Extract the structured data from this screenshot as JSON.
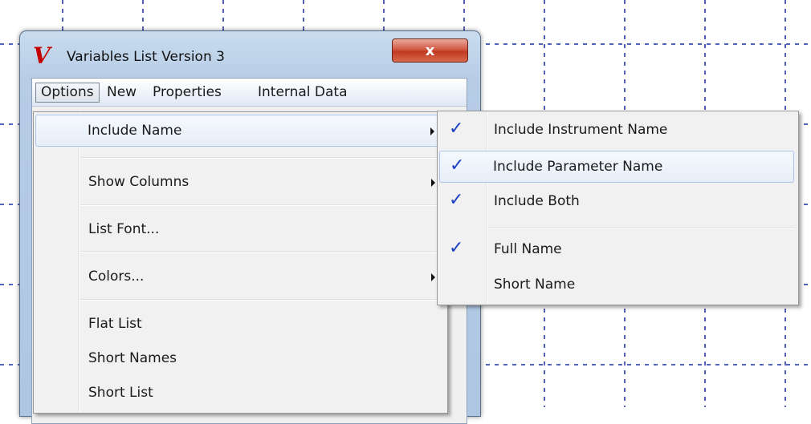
{
  "window": {
    "title": "Variables List Version 3",
    "logo_glyph": "V",
    "close_glyph": "x",
    "close_color": "#c8412c"
  },
  "menubar": {
    "items": [
      "Options",
      "New",
      "Properties",
      "Internal Data"
    ],
    "active": "Options"
  },
  "options_menu": {
    "items": [
      {
        "label": "Include Name",
        "submenu": true
      },
      {
        "label": "Show Columns",
        "submenu": true
      },
      {
        "label": "List Font...",
        "submenu": false
      },
      {
        "label": "Colors...",
        "submenu": true
      },
      {
        "label": "Flat List",
        "submenu": false
      },
      {
        "label": "Short Names",
        "submenu": false
      },
      {
        "label": "Short List",
        "submenu": false
      }
    ]
  },
  "include_name_submenu": {
    "items": [
      {
        "label": "Include Instrument Name",
        "checked": true
      },
      {
        "label": "Include Parameter Name",
        "checked": true
      },
      {
        "label": "Include Both",
        "checked": true
      },
      {
        "label": "Full Name",
        "checked": true
      },
      {
        "label": "Short Name",
        "checked": false
      }
    ],
    "check_glyph": "✓",
    "check_color": "#1c3fc4"
  },
  "grid": {
    "line_color": "#1a2f9e"
  }
}
